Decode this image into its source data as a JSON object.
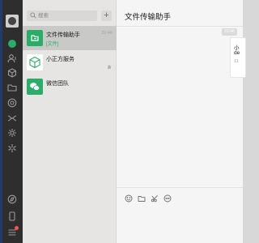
{
  "search": {
    "placeholder": "搜索"
  },
  "list": {
    "add_label": "+",
    "chats": [
      {
        "name": "文件传输助手",
        "sub": "[文件]",
        "time": "20:46",
        "active": true,
        "icon": "folder-icon"
      },
      {
        "name": "小正方服务",
        "sub": "",
        "time": "",
        "icon": "cube-icon"
      },
      {
        "name": "微信团队",
        "sub": "",
        "time": "",
        "icon": "wechat-icon"
      }
    ]
  },
  "main": {
    "title": "文件传输助手",
    "timestamp": "20:46",
    "bubble": {
      "line1": "小",
      "line2": "de",
      "line3": "11"
    }
  },
  "colors": {
    "brand_green": "#2aae67",
    "rail_bg": "#2e2e2e",
    "list_bg": "#e6e5e4",
    "main_bg": "#f5f5f5"
  }
}
